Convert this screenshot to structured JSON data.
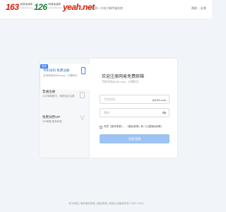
{
  "header": {
    "brands": [
      {
        "logo": "163",
        "cn": "网易免费邮",
        "en": "mail.163.com"
      },
      {
        "logo": "126",
        "cn": "网易免费邮",
        "en": "www.126.com"
      },
      {
        "logo": "yeah.net",
        "cn": "",
        "en": ""
      }
    ],
    "tagline": "中国第一大电子邮件服务商",
    "links": [
      "帮助",
      "反馈"
    ]
  },
  "sidebar": {
    "items": [
      {
        "badge": "推荐",
        "title": "手机号码 免费注册",
        "desc": "手机号码@163.com，方便好记",
        "icon": "phone-icon",
        "active": true
      },
      {
        "title": "普通注册",
        "desc": "以字母和数字，随意组合注册",
        "icon": "document-icon",
        "active": false
      },
      {
        "title": "免费试用VIP",
        "desc": "VIP邮箱·尊贵体验",
        "icon": "vip-icon",
        "active": false
      }
    ]
  },
  "form": {
    "title": "欢迎注册网易免费邮箱",
    "subtitle": "手机号码@163.com，方便好记",
    "email_placeholder": "手机号码",
    "email_value": "",
    "domain_suffix": "@163.com",
    "password_placeholder": "密码",
    "password_value": "",
    "agree_text": "同意《服务条款》、《隐私政策》和《儿童隐私政策》",
    "submit_label": "立即注册"
  },
  "footer": {
    "text": "关于网易 | 邮件服务条款 | 隐私政策 | 网易公司版权所有 ©1997-2023"
  },
  "colors": {
    "accent": "#3b82f6",
    "button": "#9cc3f3",
    "brand_red": "#d81e06",
    "brand_green": "#1f7e3b"
  }
}
